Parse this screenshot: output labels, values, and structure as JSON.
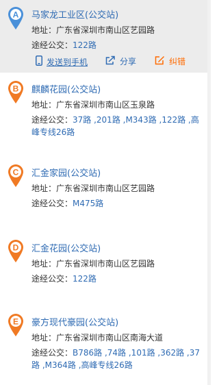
{
  "items": [
    {
      "marker": "A",
      "title": "马家龙工业区(公交站)",
      "address_label": "地址：",
      "address": "广东省深圳市南山区艺园路",
      "routes_label": "途经公交：",
      "routes_line1": "122路",
      "routes_line2": "",
      "actions": {
        "send": "发送到手机",
        "share": "分享",
        "report": "纠错"
      }
    },
    {
      "marker": "B",
      "title": "麒麟花园(公交站)",
      "address_label": "地址：",
      "address": "广东省深圳市南山区玉泉路",
      "routes_label": "途经公交：",
      "routes_line1": "37路 ,201路 ,M343路 ,122路 ,高",
      "routes_line2": "峰专线26路"
    },
    {
      "marker": "C",
      "title": "汇金家园(公交站)",
      "address_label": "地址：",
      "address": "广东省深圳市南山区艺园路",
      "routes_label": "途经公交：",
      "routes_line1": "M475路",
      "routes_line2": ""
    },
    {
      "marker": "D",
      "title": "汇金花园(公交站)",
      "address_label": "地址：",
      "address": "广东省深圳市南山区艺园路",
      "routes_label": "途经公交：",
      "routes_line1": "122路",
      "routes_line2": ""
    },
    {
      "marker": "E",
      "title": "豪方现代豪园(公交站)",
      "address_label": "地址：",
      "address": "广东省深圳市南山区南海大道",
      "routes_label": "途经公交：",
      "routes_line1": "B786路 ,74路 ,101路 ,362路 ,37",
      "routes_line2": "路 ,M364路 ,高峰专线26路"
    }
  ],
  "colors": {
    "pin_active": "#4a90d9",
    "pin_default": "#f07a24",
    "link": "#2f6bb3",
    "report": "#ff6a00"
  },
  "icons": {
    "send": "phone-icon",
    "share": "share-icon",
    "report": "edit-icon"
  }
}
